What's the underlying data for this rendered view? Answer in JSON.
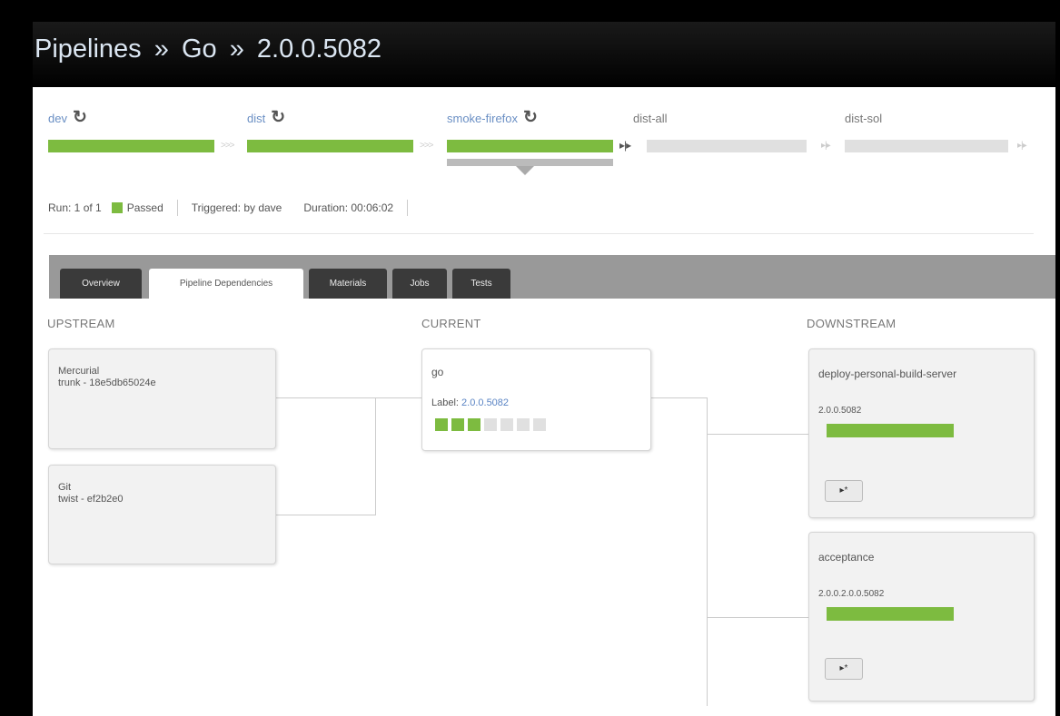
{
  "header": {
    "pipelines": "Pipelines",
    "sep": "»",
    "pipeline": "Go",
    "version": "2.0.0.5082"
  },
  "stages": [
    {
      "name": "dev",
      "status": "passed",
      "rerun_icon": "refresh-icon"
    },
    {
      "name": "dist",
      "status": "passed",
      "rerun_icon": "refresh-icon"
    },
    {
      "name": "smoke-firefox",
      "status": "passed",
      "rerun_icon": "refresh-icon",
      "selected": true
    },
    {
      "name": "dist-all",
      "status": "not-run"
    },
    {
      "name": "dist-sol",
      "status": "not-run"
    }
  ],
  "run": {
    "run": "Run: 1 of 1",
    "status": "Passed",
    "triggered": "Triggered: by dave",
    "duration": "Duration: 00:06:02"
  },
  "tabs": [
    "Overview",
    "Pipeline Dependencies",
    "Materials",
    "Jobs",
    "Tests"
  ],
  "active_tab": "Pipeline Dependencies",
  "columns": {
    "upstream": "UPSTREAM",
    "current": "CURRENT",
    "downstream": "DOWNSTREAM"
  },
  "upstream": [
    {
      "name": "Mercurial",
      "detail": "trunk - 18e5db65024e"
    },
    {
      "name": "Git",
      "detail": "twist - ef2b2e0"
    }
  ],
  "current": {
    "name": "go",
    "label_prefix": "Label:",
    "label": "2.0.0.5082",
    "stages_passed": 3,
    "stages_total": 7
  },
  "downstream": [
    {
      "name": "deploy-personal-build-server",
      "label": "2.0.0.5082",
      "trigger": "▸*"
    },
    {
      "name": "acceptance",
      "label": "2.0.0.2.0.0.5082",
      "trigger": "▸*"
    }
  ],
  "colors": {
    "passed": "#7dbb40",
    "not_run": "#e0e0e0",
    "link": "#5a84c4",
    "header_bg": "#000000"
  }
}
